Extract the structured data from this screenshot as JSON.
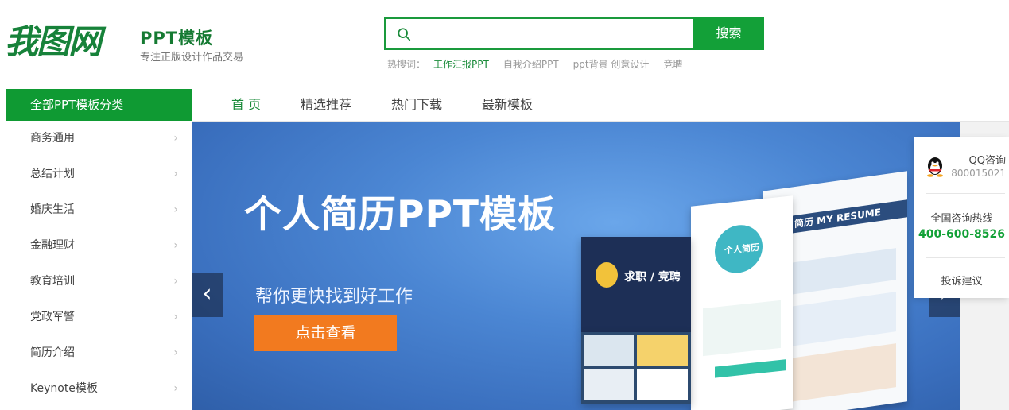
{
  "logo": {
    "text": "我图网"
  },
  "site": {
    "title": "PPT模板",
    "subtitle": "专注正版设计作品交易"
  },
  "search": {
    "value": "",
    "placeholder": "",
    "button_label": "搜索"
  },
  "hot_search": {
    "label": "热搜词：",
    "terms": [
      "工作汇报PPT",
      "自我介绍PPT",
      "ppt背景 创意设计",
      "竞聘"
    ]
  },
  "category_header": "全部PPT模板分类",
  "nav": [
    {
      "label": "首 页",
      "active": true
    },
    {
      "label": "精选推荐",
      "active": false
    },
    {
      "label": "热门下载",
      "active": false
    },
    {
      "label": "最新模板",
      "active": false
    }
  ],
  "categories": [
    "商务通用",
    "总结计划",
    "婚庆生活",
    "金融理财",
    "教育培训",
    "党政军警",
    "简历介绍",
    "Keynote模板"
  ],
  "banner": {
    "title": "个人简历PPT模板",
    "subtitle": "帮你更快找到好工作",
    "button_label": "点击查看",
    "mock_labels": [
      "个人简历",
      "求职 / 竞聘",
      "简历 MY RESUME"
    ]
  },
  "contact": {
    "qq_label": "QQ咨询",
    "qq_number": "800015021",
    "hotline_label": "全国咨询热线",
    "hotline_number": "400-600-8526",
    "complaint_label": "投诉建议"
  },
  "colors": {
    "brand_green": "#13a038",
    "accent_orange": "#f27a1f",
    "banner_blue": "#4b86d3"
  }
}
